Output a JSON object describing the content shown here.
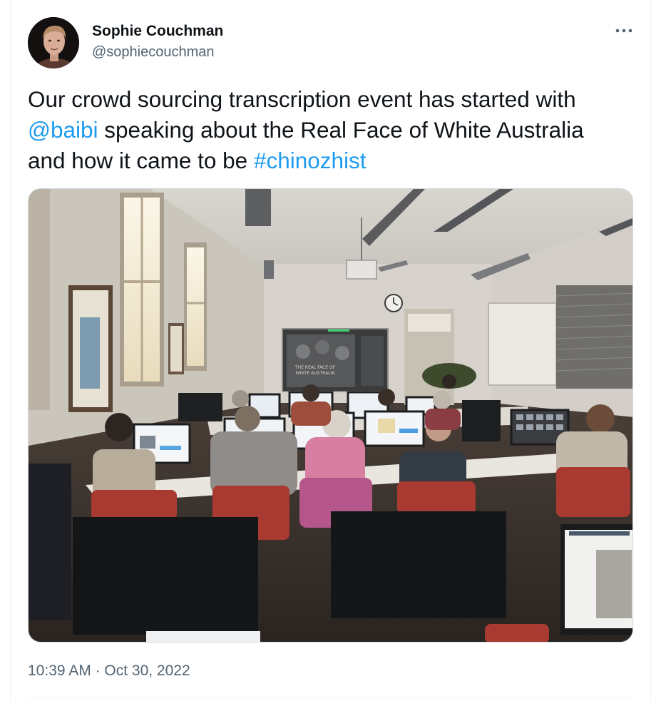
{
  "tweet": {
    "author": {
      "display_name": "Sophie Couchman",
      "handle": "@sophiecouchman"
    },
    "more_icon": "ellipsis-icon",
    "text": {
      "part1": "Our crowd sourcing transcription event has started with ",
      "mention": "@baibi",
      "part2": " speaking about the Real Face of White Australia and how it came to be ",
      "hashtag": "#chinozhist"
    },
    "media": {
      "slide_title_line1": "THE REAL FACE OF",
      "slide_title_line2": "WHITE AUSTRALIA"
    },
    "time": "10:39 AM",
    "separator": " · ",
    "date": "Oct 30, 2022",
    "colors": {
      "link": "#1d9bf0",
      "secondary_text": "#536471",
      "primary_text": "#0f1419",
      "border": "#cfd9de"
    }
  }
}
